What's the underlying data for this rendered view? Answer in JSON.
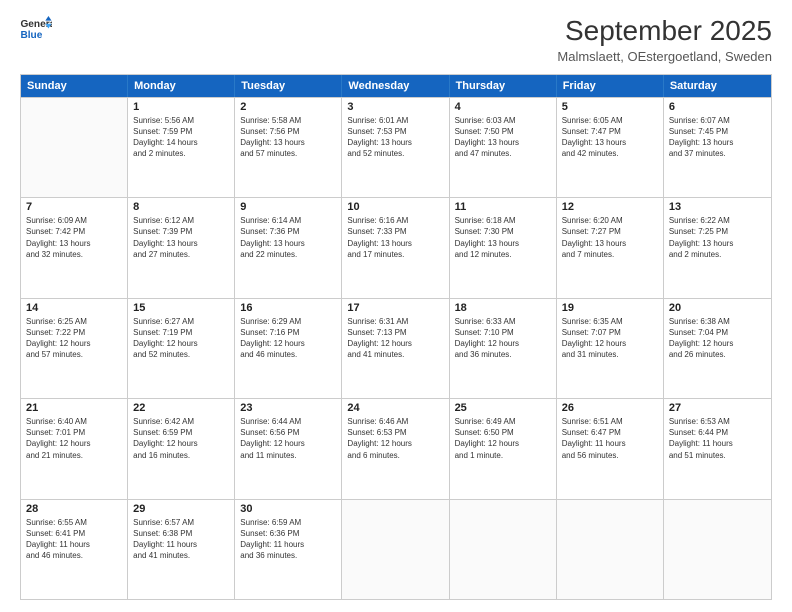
{
  "logo": {
    "line1": "General",
    "line2": "Blue"
  },
  "title": "September 2025",
  "subtitle": "Malmslaett, OEstergoetland, Sweden",
  "days_of_week": [
    "Sunday",
    "Monday",
    "Tuesday",
    "Wednesday",
    "Thursday",
    "Friday",
    "Saturday"
  ],
  "weeks": [
    [
      {
        "day": "",
        "info": ""
      },
      {
        "day": "1",
        "info": "Sunrise: 5:56 AM\nSunset: 7:59 PM\nDaylight: 14 hours\nand 2 minutes."
      },
      {
        "day": "2",
        "info": "Sunrise: 5:58 AM\nSunset: 7:56 PM\nDaylight: 13 hours\nand 57 minutes."
      },
      {
        "day": "3",
        "info": "Sunrise: 6:01 AM\nSunset: 7:53 PM\nDaylight: 13 hours\nand 52 minutes."
      },
      {
        "day": "4",
        "info": "Sunrise: 6:03 AM\nSunset: 7:50 PM\nDaylight: 13 hours\nand 47 minutes."
      },
      {
        "day": "5",
        "info": "Sunrise: 6:05 AM\nSunset: 7:47 PM\nDaylight: 13 hours\nand 42 minutes."
      },
      {
        "day": "6",
        "info": "Sunrise: 6:07 AM\nSunset: 7:45 PM\nDaylight: 13 hours\nand 37 minutes."
      }
    ],
    [
      {
        "day": "7",
        "info": "Sunrise: 6:09 AM\nSunset: 7:42 PM\nDaylight: 13 hours\nand 32 minutes."
      },
      {
        "day": "8",
        "info": "Sunrise: 6:12 AM\nSunset: 7:39 PM\nDaylight: 13 hours\nand 27 minutes."
      },
      {
        "day": "9",
        "info": "Sunrise: 6:14 AM\nSunset: 7:36 PM\nDaylight: 13 hours\nand 22 minutes."
      },
      {
        "day": "10",
        "info": "Sunrise: 6:16 AM\nSunset: 7:33 PM\nDaylight: 13 hours\nand 17 minutes."
      },
      {
        "day": "11",
        "info": "Sunrise: 6:18 AM\nSunset: 7:30 PM\nDaylight: 13 hours\nand 12 minutes."
      },
      {
        "day": "12",
        "info": "Sunrise: 6:20 AM\nSunset: 7:27 PM\nDaylight: 13 hours\nand 7 minutes."
      },
      {
        "day": "13",
        "info": "Sunrise: 6:22 AM\nSunset: 7:25 PM\nDaylight: 13 hours\nand 2 minutes."
      }
    ],
    [
      {
        "day": "14",
        "info": "Sunrise: 6:25 AM\nSunset: 7:22 PM\nDaylight: 12 hours\nand 57 minutes."
      },
      {
        "day": "15",
        "info": "Sunrise: 6:27 AM\nSunset: 7:19 PM\nDaylight: 12 hours\nand 52 minutes."
      },
      {
        "day": "16",
        "info": "Sunrise: 6:29 AM\nSunset: 7:16 PM\nDaylight: 12 hours\nand 46 minutes."
      },
      {
        "day": "17",
        "info": "Sunrise: 6:31 AM\nSunset: 7:13 PM\nDaylight: 12 hours\nand 41 minutes."
      },
      {
        "day": "18",
        "info": "Sunrise: 6:33 AM\nSunset: 7:10 PM\nDaylight: 12 hours\nand 36 minutes."
      },
      {
        "day": "19",
        "info": "Sunrise: 6:35 AM\nSunset: 7:07 PM\nDaylight: 12 hours\nand 31 minutes."
      },
      {
        "day": "20",
        "info": "Sunrise: 6:38 AM\nSunset: 7:04 PM\nDaylight: 12 hours\nand 26 minutes."
      }
    ],
    [
      {
        "day": "21",
        "info": "Sunrise: 6:40 AM\nSunset: 7:01 PM\nDaylight: 12 hours\nand 21 minutes."
      },
      {
        "day": "22",
        "info": "Sunrise: 6:42 AM\nSunset: 6:59 PM\nDaylight: 12 hours\nand 16 minutes."
      },
      {
        "day": "23",
        "info": "Sunrise: 6:44 AM\nSunset: 6:56 PM\nDaylight: 12 hours\nand 11 minutes."
      },
      {
        "day": "24",
        "info": "Sunrise: 6:46 AM\nSunset: 6:53 PM\nDaylight: 12 hours\nand 6 minutes."
      },
      {
        "day": "25",
        "info": "Sunrise: 6:49 AM\nSunset: 6:50 PM\nDaylight: 12 hours\nand 1 minute."
      },
      {
        "day": "26",
        "info": "Sunrise: 6:51 AM\nSunset: 6:47 PM\nDaylight: 11 hours\nand 56 minutes."
      },
      {
        "day": "27",
        "info": "Sunrise: 6:53 AM\nSunset: 6:44 PM\nDaylight: 11 hours\nand 51 minutes."
      }
    ],
    [
      {
        "day": "28",
        "info": "Sunrise: 6:55 AM\nSunset: 6:41 PM\nDaylight: 11 hours\nand 46 minutes."
      },
      {
        "day": "29",
        "info": "Sunrise: 6:57 AM\nSunset: 6:38 PM\nDaylight: 11 hours\nand 41 minutes."
      },
      {
        "day": "30",
        "info": "Sunrise: 6:59 AM\nSunset: 6:36 PM\nDaylight: 11 hours\nand 36 minutes."
      },
      {
        "day": "",
        "info": ""
      },
      {
        "day": "",
        "info": ""
      },
      {
        "day": "",
        "info": ""
      },
      {
        "day": "",
        "info": ""
      }
    ]
  ]
}
